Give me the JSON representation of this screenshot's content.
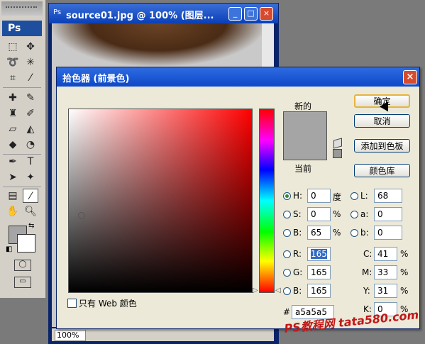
{
  "app": {
    "logo": "Ps"
  },
  "document": {
    "title": "source01.jpg @ 100% (图层...",
    "zoom": "100%",
    "window_buttons": [
      "_",
      "□",
      "×"
    ]
  },
  "toolbox": {
    "foreground_color": "#a5a5a5",
    "background_color": "#ffffff"
  },
  "picker": {
    "title": "拾色器 (前景色)",
    "close": "×",
    "new_label": "新的",
    "current_label": "当前",
    "buttons": {
      "ok": "确定",
      "cancel": "取消",
      "add_to_swatches": "添加到色板",
      "color_libraries": "颜色库"
    },
    "only_web_colors": "只有 Web 颜色",
    "hsb": {
      "h": {
        "label": "H:",
        "value": "0",
        "unit": "度"
      },
      "s": {
        "label": "S:",
        "value": "0",
        "unit": "%"
      },
      "b": {
        "label": "B:",
        "value": "65",
        "unit": "%"
      }
    },
    "rgb": {
      "r": {
        "label": "R:",
        "value": "165"
      },
      "g": {
        "label": "G:",
        "value": "165"
      },
      "b": {
        "label": "B:",
        "value": "165"
      }
    },
    "lab": {
      "l": {
        "label": "L:",
        "value": "68"
      },
      "a": {
        "label": "a:",
        "value": "0"
      },
      "b": {
        "label": "b:",
        "value": "0"
      }
    },
    "cmyk": {
      "c": {
        "label": "C:",
        "value": "41",
        "unit": "%"
      },
      "m": {
        "label": "M:",
        "value": "33",
        "unit": "%"
      },
      "y": {
        "label": "Y:",
        "value": "31",
        "unit": "%"
      },
      "k": {
        "label": "K:",
        "value": "0",
        "unit": "%"
      }
    },
    "hex": {
      "label": "#",
      "value": "a5a5a5"
    },
    "selected_color": "#a5a5a5"
  },
  "watermark": "PS教程网 tata580.com"
}
